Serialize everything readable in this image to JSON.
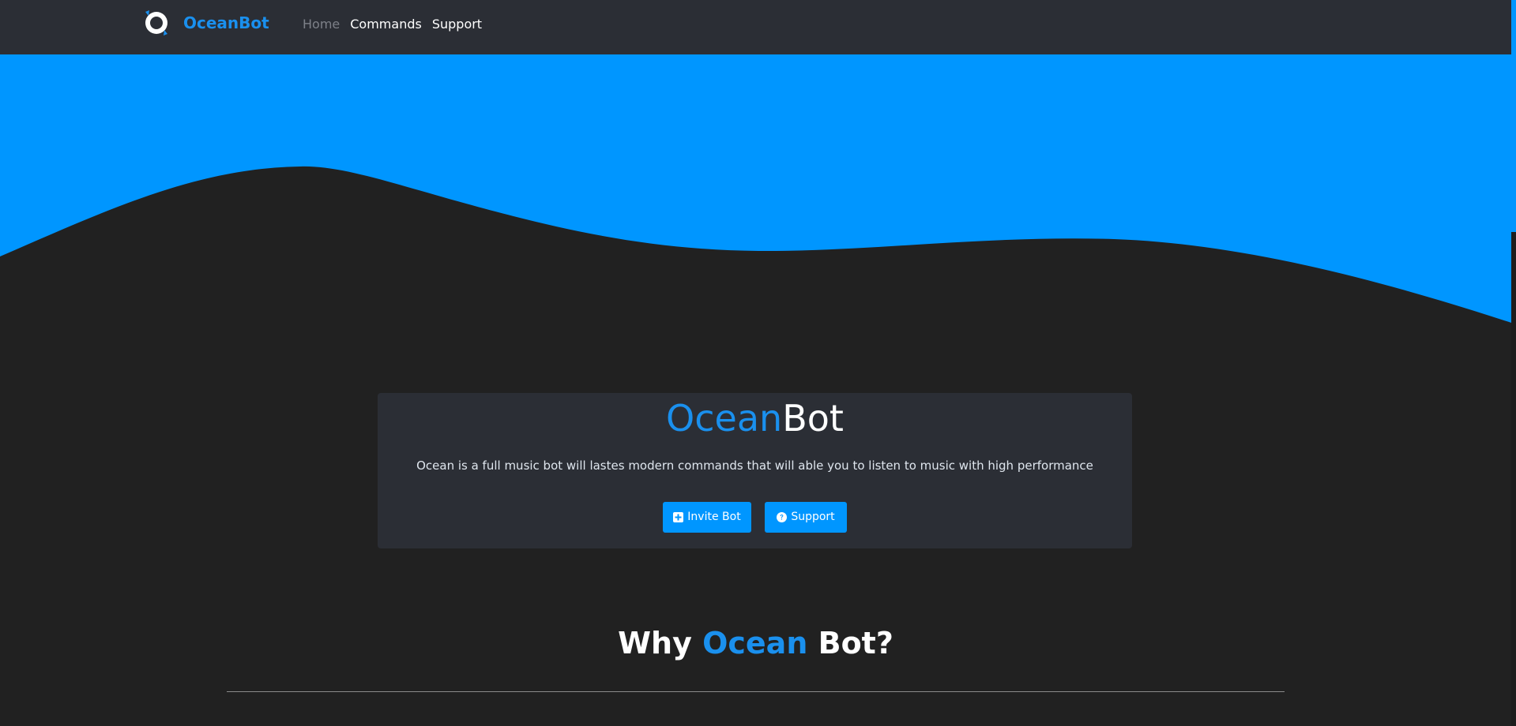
{
  "navbar": {
    "brand_name": "OceanBot",
    "links": [
      {
        "label": "Home",
        "active": true
      },
      {
        "label": "Commands",
        "active": false
      },
      {
        "label": "Support",
        "active": false
      }
    ]
  },
  "hero": {
    "wave_color": "#0096ff",
    "background_color": "#212121"
  },
  "card": {
    "title_accent": "Ocean",
    "title_plain": "Bot",
    "description": "Ocean is a full music bot will lastes modern commands that will able you to listen to music with high performance",
    "buttons": [
      {
        "label": "Invite Bot",
        "icon": "plus-square-icon"
      },
      {
        "label": "Support",
        "icon": "question-circle-icon"
      }
    ]
  },
  "why_section": {
    "title_prefix": "Why ",
    "title_accent": "Ocean",
    "title_suffix": " Bot?"
  },
  "colors": {
    "accent": "#1a90ee",
    "button": "#0096ff",
    "navbar": "#2b2e35",
    "card": "#2b2e35",
    "page": "#212121"
  }
}
